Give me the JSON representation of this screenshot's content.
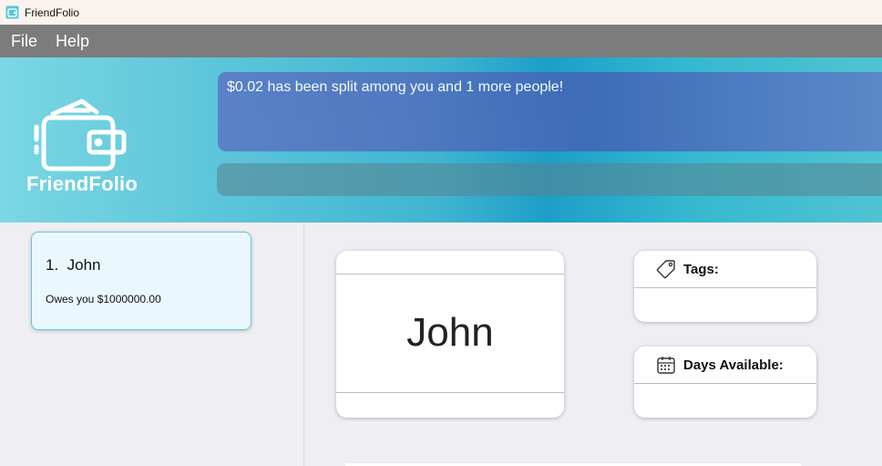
{
  "window": {
    "title": "FriendFolio",
    "icon": "app-icon"
  },
  "menu": {
    "items": [
      {
        "label": "File"
      },
      {
        "label": "Help"
      }
    ]
  },
  "banner": {
    "logo_text": "FriendFolio",
    "result_message": "$0.02 has been split among you and 1 more people!",
    "command_input_value": ""
  },
  "person_list": [
    {
      "index": "1.",
      "name": "John",
      "owes": "Owes you $1000000.00"
    }
  ],
  "detail": {
    "name": "John",
    "tags_label": "Tags:",
    "days_label": "Days Available:"
  },
  "colors": {
    "accent": "#1d9ec8",
    "result_box": "#4f76c0",
    "card_border": "#6ac5db"
  }
}
